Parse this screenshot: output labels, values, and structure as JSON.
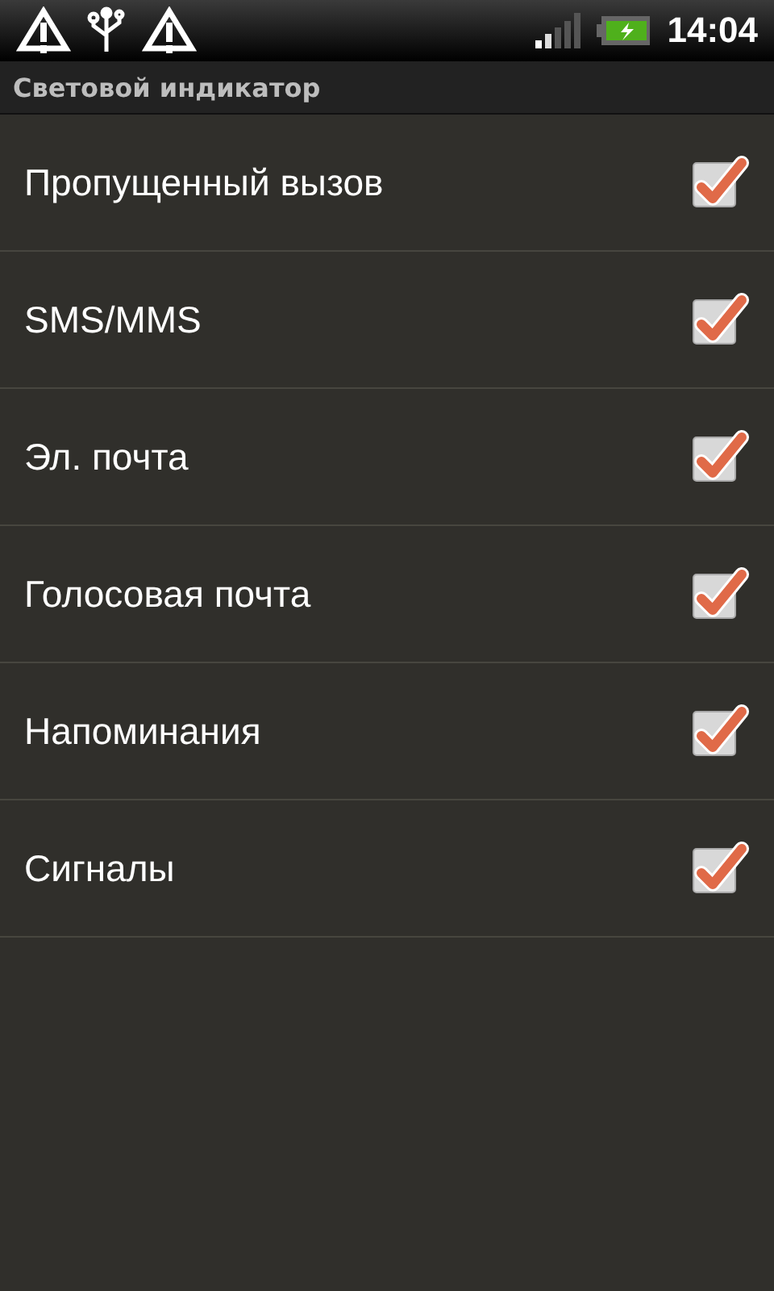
{
  "status_bar": {
    "time": "14:04"
  },
  "header": {
    "title": "Световой индикатор"
  },
  "items": [
    {
      "label": "Пропущенный вызов",
      "checked": true
    },
    {
      "label": "SMS/MMS",
      "checked": true
    },
    {
      "label": "Эл. почта",
      "checked": true
    },
    {
      "label": "Голосовая почта",
      "checked": true
    },
    {
      "label": "Напоминания",
      "checked": true
    },
    {
      "label": "Сигналы",
      "checked": true
    }
  ]
}
